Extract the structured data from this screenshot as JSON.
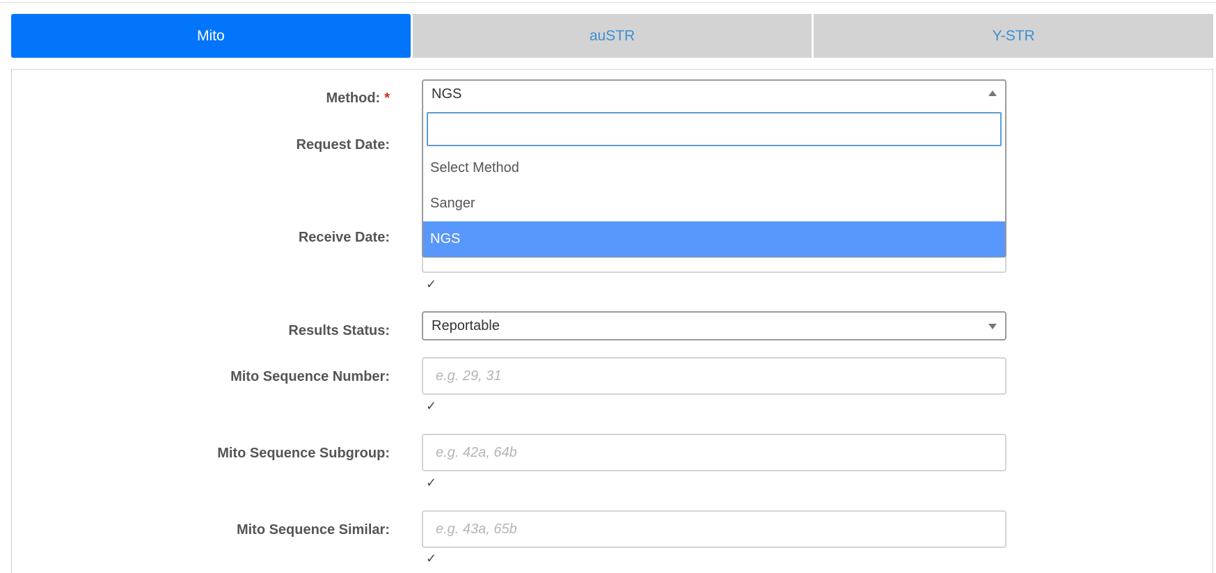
{
  "tabs": [
    {
      "label": "Mito",
      "active": true
    },
    {
      "label": "auSTR",
      "active": false
    },
    {
      "label": "Y-STR",
      "active": false
    }
  ],
  "form": {
    "method": {
      "label": "Method:",
      "required_mark": "*",
      "selected": "NGS",
      "search_value": "",
      "options": [
        "Select Method",
        "Sanger",
        "NGS"
      ]
    },
    "request_date": {
      "label": "Request Date:"
    },
    "receive_date": {
      "label": "Receive Date:",
      "check": "✓"
    },
    "results_status": {
      "label": "Results Status:",
      "selected": "Reportable"
    },
    "mito_sequence_number": {
      "label": "Mito Sequence Number:",
      "placeholder": "e.g. 29, 31",
      "check": "✓"
    },
    "mito_sequence_subgroup": {
      "label": "Mito Sequence Subgroup:",
      "placeholder": "e.g. 42a, 64b",
      "check": "✓"
    },
    "mito_sequence_similar": {
      "label": "Mito Sequence Similar:",
      "placeholder": "e.g. 43a, 65b",
      "check": "✓"
    }
  },
  "colors": {
    "active_tab": "#0275fa",
    "inactive_tab": "#d3d3d3",
    "tab_link": "#3b8fd6",
    "highlight_option": "#5897fb",
    "required": "#d9261c"
  }
}
